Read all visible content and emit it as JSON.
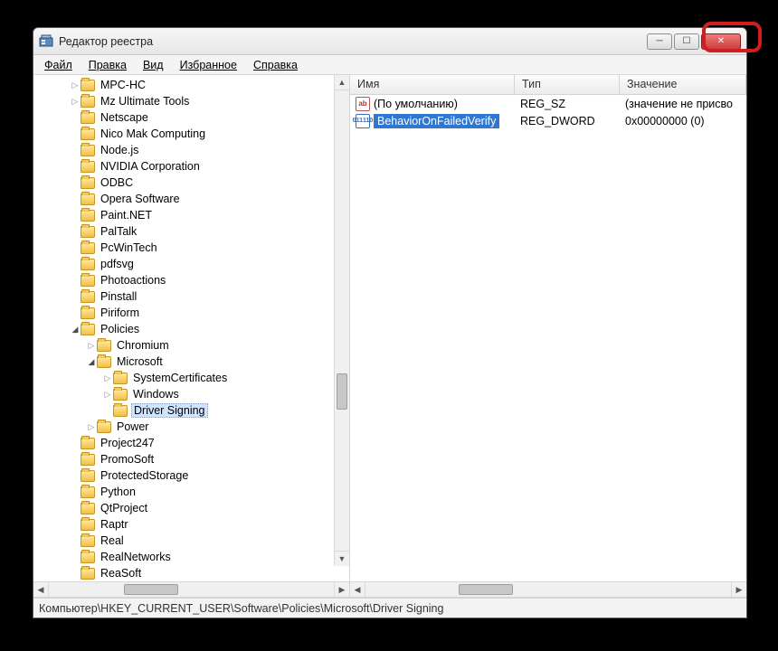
{
  "title": "Редактор реестра",
  "menu": {
    "file": "Файл",
    "edit": "Правка",
    "view": "Вид",
    "fav": "Избранное",
    "help": "Справка"
  },
  "columns": {
    "name": "Имя",
    "type": "Тип",
    "value": "Значение"
  },
  "values": [
    {
      "icon": "sz",
      "name": "(По умолчанию)",
      "type": "REG_SZ",
      "value": "(значение не присво",
      "selected": false
    },
    {
      "icon": "dw",
      "name": "BehaviorOnFailedVerify",
      "type": "REG_DWORD",
      "value": "0x00000000 (0)",
      "selected": true
    }
  ],
  "tree": [
    {
      "label": "MPC-HC",
      "depth": 4,
      "arrow": "closed"
    },
    {
      "label": "Mz Ultimate Tools",
      "depth": 4,
      "arrow": "closed"
    },
    {
      "label": "Netscape",
      "depth": 4,
      "arrow": "none"
    },
    {
      "label": "Nico Mak Computing",
      "depth": 4,
      "arrow": "none"
    },
    {
      "label": "Node.js",
      "depth": 4,
      "arrow": "none"
    },
    {
      "label": "NVIDIA Corporation",
      "depth": 4,
      "arrow": "none"
    },
    {
      "label": "ODBC",
      "depth": 4,
      "arrow": "none"
    },
    {
      "label": "Opera Software",
      "depth": 4,
      "arrow": "none"
    },
    {
      "label": "Paint.NET",
      "depth": 4,
      "arrow": "none"
    },
    {
      "label": "PalTalk",
      "depth": 4,
      "arrow": "none"
    },
    {
      "label": "PcWinTech",
      "depth": 4,
      "arrow": "none"
    },
    {
      "label": "pdfsvg",
      "depth": 4,
      "arrow": "none"
    },
    {
      "label": "Photoactions",
      "depth": 4,
      "arrow": "none"
    },
    {
      "label": "Pinstall",
      "depth": 4,
      "arrow": "none"
    },
    {
      "label": "Piriform",
      "depth": 4,
      "arrow": "none"
    },
    {
      "label": "Policies",
      "depth": 4,
      "arrow": "open"
    },
    {
      "label": "Chromium",
      "depth": 5,
      "arrow": "closed"
    },
    {
      "label": "Microsoft",
      "depth": 5,
      "arrow": "open"
    },
    {
      "label": "SystemCertificates",
      "depth": 6,
      "arrow": "closed"
    },
    {
      "label": "Windows",
      "depth": 6,
      "arrow": "closed"
    },
    {
      "label": "Driver Signing",
      "depth": 6,
      "arrow": "none",
      "selected": true
    },
    {
      "label": "Power",
      "depth": 5,
      "arrow": "closed"
    },
    {
      "label": "Project247",
      "depth": 4,
      "arrow": "none"
    },
    {
      "label": "PromoSoft",
      "depth": 4,
      "arrow": "none"
    },
    {
      "label": "ProtectedStorage",
      "depth": 4,
      "arrow": "none"
    },
    {
      "label": "Python",
      "depth": 4,
      "arrow": "none"
    },
    {
      "label": "QtProject",
      "depth": 4,
      "arrow": "none"
    },
    {
      "label": "Raptr",
      "depth": 4,
      "arrow": "none"
    },
    {
      "label": "Real",
      "depth": 4,
      "arrow": "none"
    },
    {
      "label": "RealNetworks",
      "depth": 4,
      "arrow": "none"
    },
    {
      "label": "ReaSoft",
      "depth": 4,
      "arrow": "none"
    }
  ],
  "statusbar": "Компьютер\\HKEY_CURRENT_USER\\Software\\Policies\\Microsoft\\Driver Signing"
}
